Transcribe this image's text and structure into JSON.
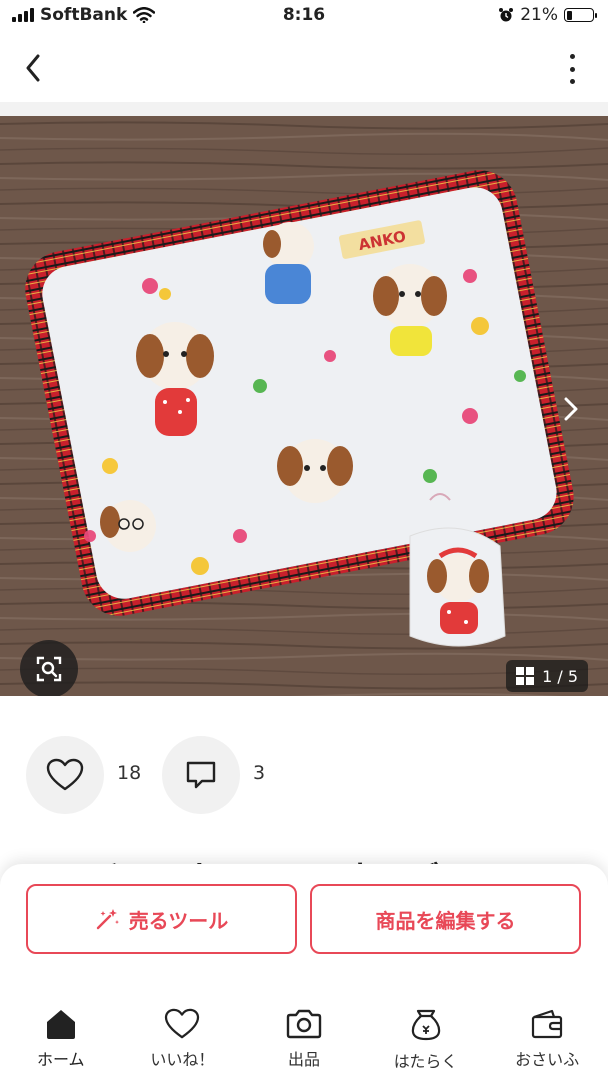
{
  "status_bar": {
    "carrier": "SoftBank",
    "time": "8:16",
    "battery": "21%",
    "battery_level": 0.21
  },
  "nav": {
    "back_icon": "chevron-left-icon",
    "more_icon": "more-vertical-icon"
  },
  "photo": {
    "counter": "1 / 5",
    "block_text": "ANKO",
    "icons": [
      "image-search-icon",
      "grid-icon",
      "chevron-right-icon"
    ]
  },
  "reactions": {
    "likes": "18",
    "comments": "3"
  },
  "item": {
    "title_partial": "マルチマット　アンスカーバーフル"
  },
  "actions": {
    "sell_tools": "売るツール",
    "edit_item": "商品を編集する"
  },
  "tabs": [
    {
      "label": "ホーム",
      "icon": "home-icon"
    },
    {
      "label": "いいね！",
      "icon": "heart-icon"
    },
    {
      "label": "出品",
      "icon": "camera-icon"
    },
    {
      "label": "はたらく",
      "icon": "money-bag-icon"
    },
    {
      "label": "おさいふ",
      "icon": "wallet-icon"
    }
  ],
  "colors": {
    "accent": "#e84857",
    "wood": "#6b5548",
    "plaid": "#c8202c"
  }
}
